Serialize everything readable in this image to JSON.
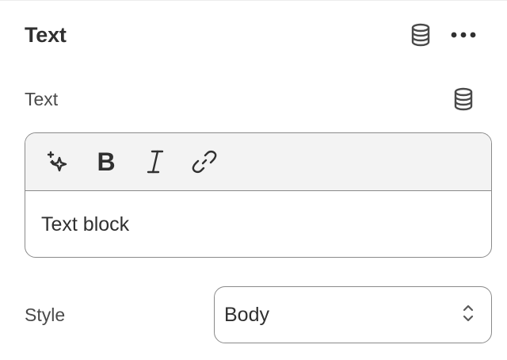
{
  "header": {
    "title": "Text",
    "dynamic_source_icon": "database-icon",
    "more_icon": "more-horizontal-icon"
  },
  "text_field": {
    "label": "Text",
    "dynamic_source_icon": "database-icon"
  },
  "editor": {
    "toolbar": {
      "magic_icon": "sparkle-icon",
      "bold_label": "B",
      "italic_icon": "italic-icon",
      "link_icon": "link-icon"
    },
    "content": "Text block"
  },
  "style_field": {
    "label": "Style",
    "selected": "Body",
    "select_icon": "chevron-up-down-icon"
  },
  "colors": {
    "text": "#303030",
    "border": "#8a8a8a",
    "toolbar_bg": "#f3f3f3"
  }
}
